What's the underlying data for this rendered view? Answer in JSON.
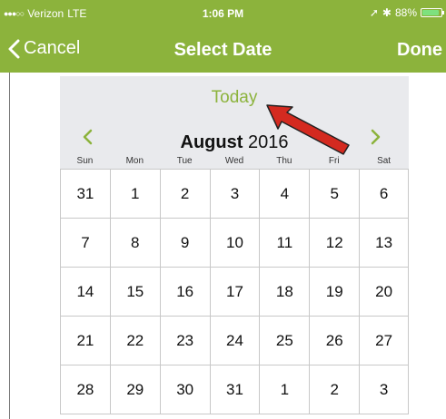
{
  "status": {
    "carrier": "Verizon",
    "network": "LTE",
    "time": "1:06 PM",
    "battery": "88%",
    "battery_level": 0.88,
    "signal_dots": "●●●○○"
  },
  "nav": {
    "cancel": "Cancel",
    "title": "Select Date",
    "done": "Done"
  },
  "calendar": {
    "today": "Today",
    "month": "August",
    "year": "2016",
    "weekdays": [
      "Sun",
      "Mon",
      "Tue",
      "Wed",
      "Thu",
      "Fri",
      "Sat"
    ],
    "weeks": [
      [
        "31",
        "1",
        "2",
        "3",
        "4",
        "5",
        "6"
      ],
      [
        "7",
        "8",
        "9",
        "10",
        "11",
        "12",
        "13"
      ],
      [
        "14",
        "15",
        "16",
        "17",
        "18",
        "19",
        "20"
      ],
      [
        "21",
        "22",
        "23",
        "24",
        "25",
        "26",
        "27"
      ],
      [
        "28",
        "29",
        "30",
        "31",
        "1",
        "2",
        "3"
      ]
    ]
  },
  "colors": {
    "accent": "#8cb33c",
    "header_bg": "#e9eaed",
    "annotation": "#d42a20"
  }
}
